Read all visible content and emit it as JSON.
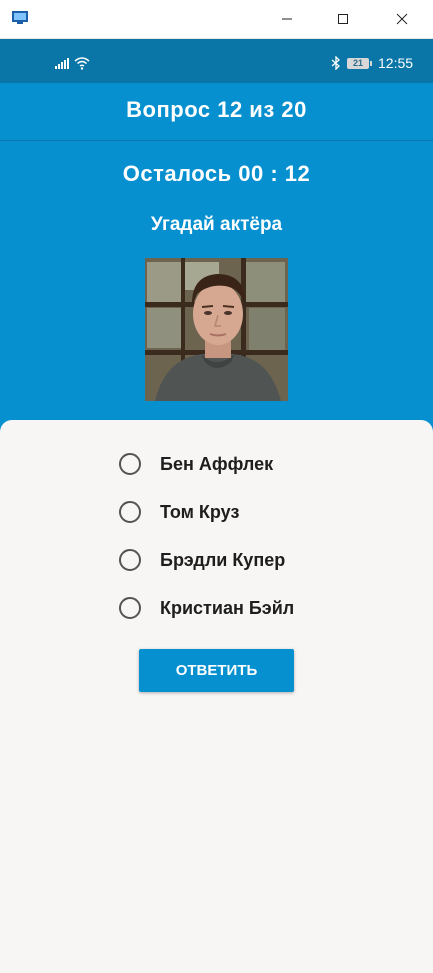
{
  "status_bar": {
    "battery_level": "21",
    "clock": "12:55"
  },
  "quiz": {
    "question_counter": "Вопрос 12 из 20",
    "timer_text": "Осталось 00 : 12",
    "prompt": "Угадай актёра",
    "options": [
      {
        "label": "Бен Аффлек"
      },
      {
        "label": "Том Круз"
      },
      {
        "label": "Брэдли Купер"
      },
      {
        "label": "Кристиан Бэйл"
      }
    ],
    "submit_label": "ОТВЕТИТЬ"
  },
  "colors": {
    "primary": "#0690cf",
    "status_bar": "#0a76a8",
    "sheet": "#f8f6f5"
  }
}
